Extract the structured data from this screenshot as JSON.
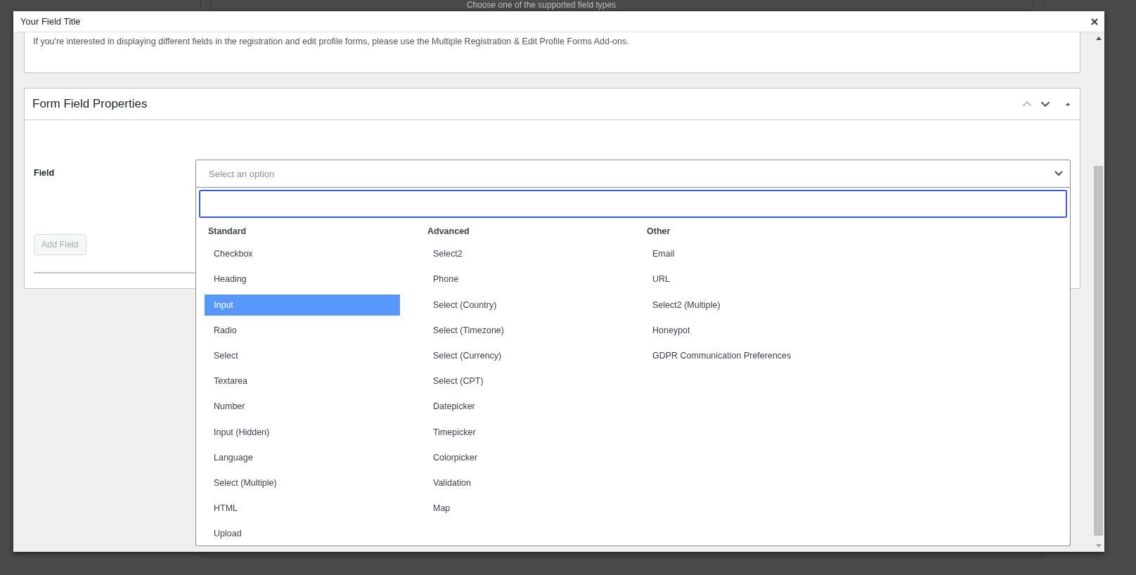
{
  "background": {
    "text": "Choose one of the supported field types"
  },
  "modal": {
    "title": "Your Field Title"
  },
  "notice": {
    "text": "If you're interested in displaying different fields in the registration and edit profile forms, please use the Multiple Registration & Edit Profile Forms Add-ons."
  },
  "panel": {
    "title": "Form Field Properties",
    "handle_actions": [
      {
        "kind": "up",
        "disabled": true
      },
      {
        "kind": "down",
        "disabled": false
      },
      {
        "kind": "toggle",
        "disabled": false
      }
    ],
    "field_label": "Field",
    "select": {
      "placeholder": "Select an option",
      "expanded": true
    },
    "groups": [
      {
        "label": "Standard",
        "options": [
          {
            "label": "Checkbox",
            "selected": false
          },
          {
            "label": "Heading",
            "selected": false
          },
          {
            "label": "Input",
            "selected": true
          },
          {
            "label": "Radio",
            "selected": false
          },
          {
            "label": "Select",
            "selected": false
          },
          {
            "label": "Textarea",
            "selected": false
          },
          {
            "label": "Number",
            "selected": false
          },
          {
            "label": "Input (Hidden)",
            "selected": false
          },
          {
            "label": "Language",
            "selected": false
          },
          {
            "label": "Select (Multiple)",
            "selected": false
          },
          {
            "label": "HTML",
            "selected": false
          },
          {
            "label": "Upload",
            "selected": false
          }
        ]
      },
      {
        "label": "Advanced",
        "options": [
          {
            "label": "Select2",
            "selected": false
          },
          {
            "label": "Phone",
            "selected": false
          },
          {
            "label": "Select (Country)",
            "selected": false
          },
          {
            "label": "Select (Timezone)",
            "selected": false
          },
          {
            "label": "Select (Currency)",
            "selected": false
          },
          {
            "label": "Select (CPT)",
            "selected": false
          },
          {
            "label": "Datepicker",
            "selected": false
          },
          {
            "label": "Timepicker",
            "selected": false
          },
          {
            "label": "Colorpicker",
            "selected": false
          },
          {
            "label": "Validation",
            "selected": false
          },
          {
            "label": "Map",
            "selected": false
          }
        ]
      },
      {
        "label": "Other",
        "options": [
          {
            "label": "Email",
            "selected": false
          },
          {
            "label": "URL",
            "selected": false
          },
          {
            "label": "Select2 (Multiple)",
            "selected": false
          },
          {
            "label": "Honeypot",
            "selected": false
          },
          {
            "label": "GDPR Communication Preferences",
            "selected": false
          }
        ]
      }
    ],
    "add_button": {
      "label": "Add Field",
      "disabled": true
    }
  }
}
